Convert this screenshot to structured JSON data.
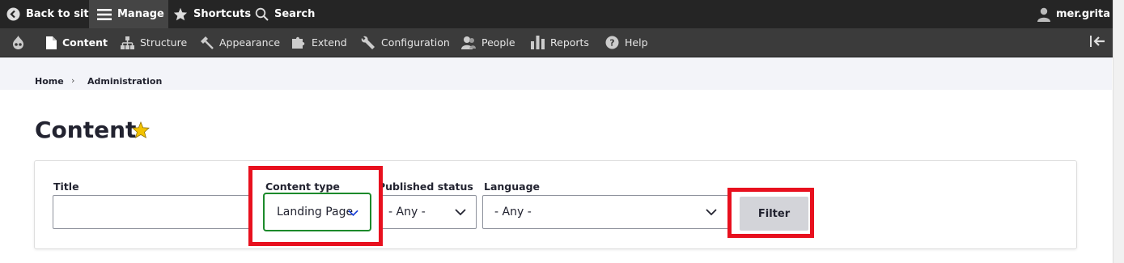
{
  "toolbar": {
    "back_label": "Back to site",
    "manage_label": "Manage",
    "shortcuts_label": "Shortcuts",
    "search_label": "Search",
    "user_label": "mer.grita"
  },
  "admin_menu": {
    "items": [
      {
        "label": "Content",
        "icon": "file-icon"
      },
      {
        "label": "Structure",
        "icon": "sitemap-icon"
      },
      {
        "label": "Appearance",
        "icon": "paintbrush-icon"
      },
      {
        "label": "Extend",
        "icon": "puzzle-icon"
      },
      {
        "label": "Configuration",
        "icon": "wrench-icon"
      },
      {
        "label": "People",
        "icon": "people-icon"
      },
      {
        "label": "Reports",
        "icon": "bar-chart-icon"
      },
      {
        "label": "Help",
        "icon": "help-icon"
      }
    ]
  },
  "breadcrumb": {
    "home": "Home",
    "sep": "›",
    "current": "Administration"
  },
  "page": {
    "title": "Content"
  },
  "filters": {
    "title_label": "Title",
    "title_value": "",
    "content_type_label": "Content type",
    "content_type_value": "Landing Page",
    "published_label": "Published status",
    "published_value": "- Any -",
    "language_label": "Language",
    "language_value": "- Any -",
    "filter_button": "Filter"
  },
  "colors": {
    "toolbar_bg": "#252525",
    "menu_bg": "#3b3b3b",
    "highlight_red": "#e8101e",
    "focus_green": "#1c8a2b",
    "star_yellow": "#f2c200"
  }
}
